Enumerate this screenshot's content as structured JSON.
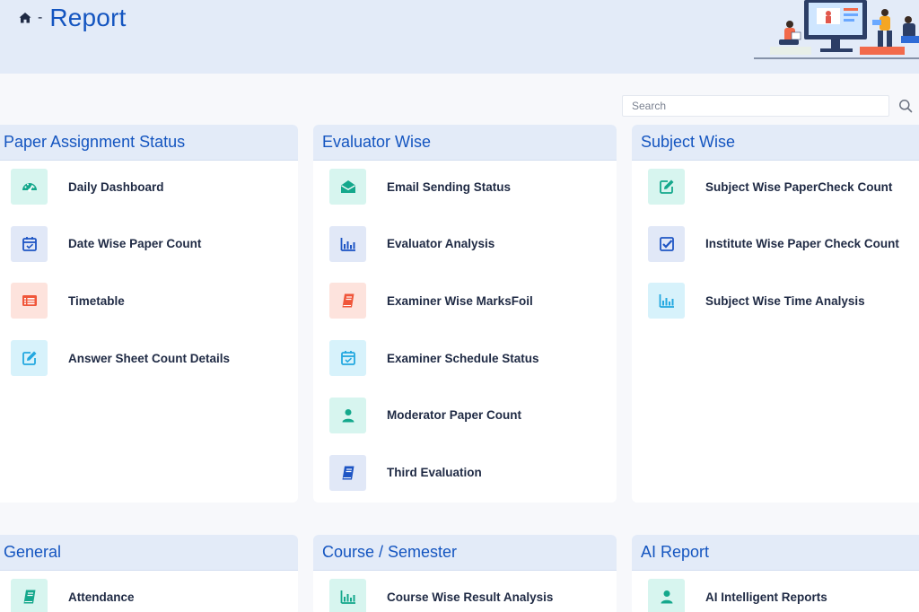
{
  "header": {
    "breadcrumb_separator": "-",
    "title": "Report"
  },
  "search": {
    "placeholder": "Search"
  },
  "colors": {
    "accent": "#1455c0",
    "header_bg": "#e3ebf8",
    "teal_icon": "#14a88c",
    "blue_icon": "#1e55c4",
    "red_icon": "#f0563a",
    "cyan_icon": "#23a8e0"
  },
  "sections": [
    {
      "title": "Paper Assignment Status",
      "items": [
        {
          "label": "Daily Dashboard",
          "icon": "dashboard-icon",
          "tone": "teal"
        },
        {
          "label": "Date Wise Paper Count",
          "icon": "calendar-check-icon",
          "tone": "blue"
        },
        {
          "label": "Timetable",
          "icon": "list-alt-icon",
          "tone": "red"
        },
        {
          "label": "Answer Sheet Count Details",
          "icon": "edit-icon",
          "tone": "cyan"
        }
      ]
    },
    {
      "title": "Evaluator Wise",
      "items": [
        {
          "label": "Email Sending Status",
          "icon": "envelope-open-icon",
          "tone": "teal"
        },
        {
          "label": "Evaluator Analysis",
          "icon": "bar-chart-icon",
          "tone": "blue"
        },
        {
          "label": "Examiner Wise MarksFoil",
          "icon": "book-icon",
          "tone": "red"
        },
        {
          "label": "Examiner Schedule Status",
          "icon": "calendar-check-icon",
          "tone": "cyan"
        },
        {
          "label": "Moderator Paper Count",
          "icon": "user-icon",
          "tone": "teal"
        },
        {
          "label": "Third Evaluation",
          "icon": "book-icon",
          "tone": "blue"
        }
      ]
    },
    {
      "title": "Subject Wise",
      "items": [
        {
          "label": "Subject Wise PaperCheck Count",
          "icon": "edit-icon",
          "tone": "teal"
        },
        {
          "label": "Institute Wise Paper Check Count",
          "icon": "check-square-icon",
          "tone": "blue"
        },
        {
          "label": "Subject Wise Time Analysis",
          "icon": "bar-chart-icon",
          "tone": "cyan"
        }
      ]
    },
    {
      "title": "General",
      "items": [
        {
          "label": "Attendance",
          "icon": "book-icon",
          "tone": "teal"
        }
      ]
    },
    {
      "title": "Course / Semester",
      "items": [
        {
          "label": "Course Wise Result Analysis",
          "icon": "bar-chart-icon",
          "tone": "teal"
        }
      ]
    },
    {
      "title": "AI Report",
      "items": [
        {
          "label": "AI Intelligent Reports",
          "icon": "user-icon",
          "tone": "teal"
        }
      ]
    }
  ]
}
